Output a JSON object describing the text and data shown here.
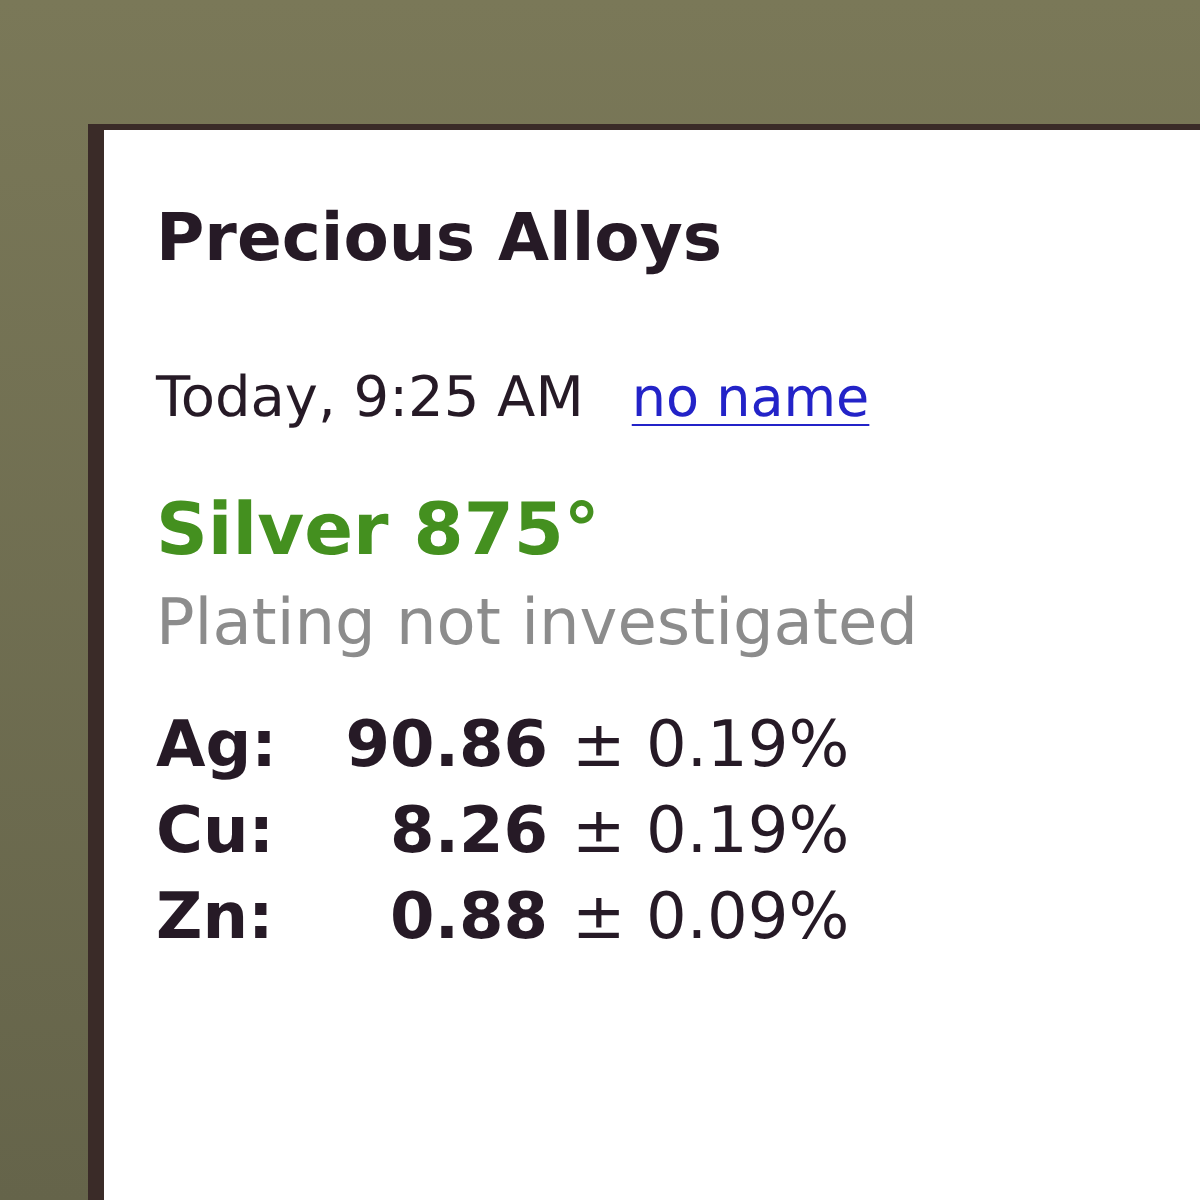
{
  "header": {
    "title": "Precious Alloys"
  },
  "measurement": {
    "timestamp": "Today, 9:25 AM",
    "sample_name": "no name"
  },
  "result": {
    "grade": "Silver 875°",
    "note": "Plating not investigated"
  },
  "elements": [
    {
      "symbol": "Ag:",
      "value": "90.86",
      "uncertainty": "± 0.19%"
    },
    {
      "symbol": "Cu:",
      "value": "8.26",
      "uncertainty": "± 0.19%"
    },
    {
      "symbol": "Zn:",
      "value": "0.88",
      "uncertainty": "± 0.09%"
    }
  ]
}
